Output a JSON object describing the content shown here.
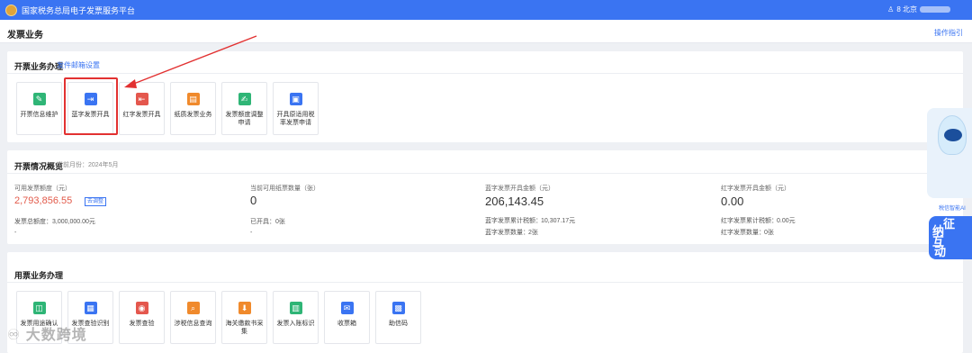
{
  "topbar": {
    "title": "国家税务总局电子发票服务平台",
    "user_prefix": "8  北京"
  },
  "page": {
    "title": "发票业务",
    "guide_link": "操作指引"
  },
  "issue_section": {
    "title": "开票业务办理",
    "link": "发件邮箱设置",
    "tiles": [
      {
        "label": "开票信息维护"
      },
      {
        "label": "蓝字发票开具"
      },
      {
        "label": "红字发票开具"
      },
      {
        "label": "纸质发票业务"
      },
      {
        "label": "发票额度调整申请"
      },
      {
        "label": "开具原适用税率发票申请"
      }
    ]
  },
  "overview_section": {
    "title": "开票情况概览",
    "period": "当前月份：2024年5月",
    "col1": {
      "label": "可用发票额度（元）",
      "value": "2,793,856.55",
      "tag": "去调整",
      "total_label": "发票总额度：",
      "total_value": "3,000,000.00元",
      "dash": "-"
    },
    "col2": {
      "label": "当前可用纸票数量（张）",
      "value": "0",
      "issued_label": "已开具：",
      "issued_value": "0张",
      "dash": "-"
    },
    "col3": {
      "label": "蓝字发票开具金额（元）",
      "value": "206,143.45",
      "cum_label": "蓝字发票累计税额：",
      "cum_value": "10,307.17元",
      "count_label": "蓝字发票数量：",
      "count_value": "2张"
    },
    "col4": {
      "label": "红字发票开具金额（元）",
      "value": "0.00",
      "cum_label": "红字发票累计税额：",
      "cum_value": "0.00元",
      "count_label": "红字发票数量：",
      "count_value": "0张"
    }
  },
  "ticket_section": {
    "title": "用票业务办理",
    "tiles": [
      {
        "label": "发票用途确认"
      },
      {
        "label": "发票查验识别"
      },
      {
        "label": "发票查验"
      },
      {
        "label": "涉税信息查询"
      },
      {
        "label": "海关缴款书采集"
      },
      {
        "label": "发票入账标识"
      },
      {
        "label": "收票箱"
      },
      {
        "label": "助信码"
      }
    ]
  },
  "float": {
    "robot_caption": "税信智能AI",
    "badge_chars": [
      "征",
      "纳",
      "互",
      "动"
    ]
  },
  "watermark": "大数跨境",
  "colors": {
    "brand": "#3a74f2",
    "highlight": "#e23131",
    "amount_red": "#e25a4a"
  }
}
